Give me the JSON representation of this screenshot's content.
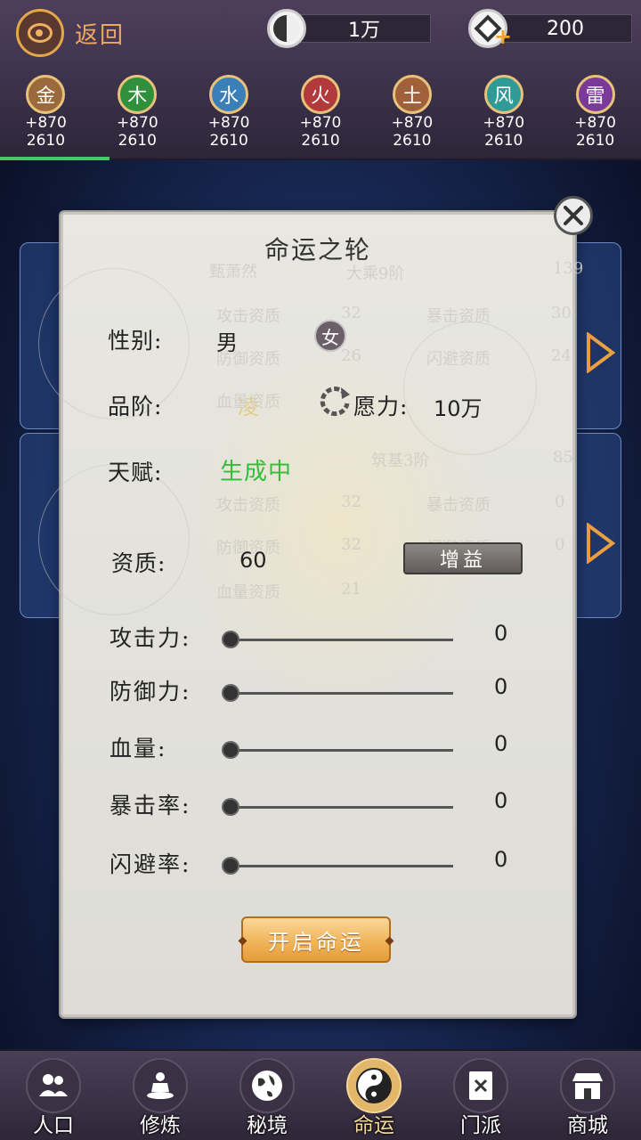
{
  "header": {
    "back_label": "返回",
    "resource_1": {
      "value": "1万",
      "icon": "yinyang-coin-icon"
    },
    "resource_2": {
      "value": "200",
      "icon": "diamond-gem-icon"
    }
  },
  "elements": [
    {
      "name": "金",
      "bonus": "+870",
      "value": "2610",
      "color": "#9b6a3c"
    },
    {
      "name": "木",
      "bonus": "+870",
      "value": "2610",
      "color": "#2f8f3b"
    },
    {
      "name": "水",
      "bonus": "+870",
      "value": "2610",
      "color": "#3a7fb8"
    },
    {
      "name": "火",
      "bonus": "+870",
      "value": "2610",
      "color": "#b23a3a"
    },
    {
      "name": "土",
      "bonus": "+870",
      "value": "2610",
      "color": "#a0603a"
    },
    {
      "name": "风",
      "bonus": "+870",
      "value": "2610",
      "color": "#2f9a96"
    },
    {
      "name": "雷",
      "bonus": "+870",
      "value": "2610",
      "color": "#7a3a9a"
    }
  ],
  "modal": {
    "title": "命运之轮",
    "gender_label": "性别:",
    "gender_value": "男",
    "gender_alt": "女",
    "rank_label": "品阶:",
    "wish_label": "愿力:",
    "wish_value": "10万",
    "talent_label": "天赋:",
    "talent_value": "生成中",
    "aptitude_label": "资质:",
    "aptitude_value": "60",
    "boost_button": "增益",
    "stats": [
      {
        "label": "攻击力:",
        "value": "0"
      },
      {
        "label": "防御力:",
        "value": "0"
      },
      {
        "label": "血量:",
        "value": "0"
      },
      {
        "label": "暴击率:",
        "value": "0"
      },
      {
        "label": "闪避率:",
        "value": "0"
      }
    ],
    "open_button": "开启命运"
  },
  "background_cards": {
    "card1": {
      "name": "甄萧然",
      "realm": "大乘9阶",
      "score": "139",
      "rank_glyph": "凌",
      "attrs": [
        {
          "label": "攻击资质",
          "value": "32"
        },
        {
          "label": "暴击资质",
          "value": "30"
        },
        {
          "label": "防御资质",
          "value": "26"
        },
        {
          "label": "闪避资质",
          "value": "24"
        },
        {
          "label": "血量资质",
          "value": ""
        }
      ]
    },
    "card2": {
      "realm": "筑基3阶",
      "score": "85",
      "attrs": [
        {
          "label": "攻击资质",
          "value": "32"
        },
        {
          "label": "暴击资质",
          "value": "0"
        },
        {
          "label": "防御资质",
          "value": "32"
        },
        {
          "label": "闪避资质",
          "value": "0"
        },
        {
          "label": "血量资质",
          "value": "21"
        }
      ]
    }
  },
  "bottom_nav": [
    {
      "label": "人口",
      "icon": "people-icon"
    },
    {
      "label": "修炼",
      "icon": "meditation-icon"
    },
    {
      "label": "秘境",
      "icon": "globe-icon"
    },
    {
      "label": "命运",
      "icon": "yinyang-icon",
      "active": true
    },
    {
      "label": "门派",
      "icon": "sect-book-icon"
    },
    {
      "label": "商城",
      "icon": "shop-icon"
    }
  ],
  "colors": {
    "accent_green": "#2fbf3a",
    "accent_gold": "#f0b55a"
  }
}
